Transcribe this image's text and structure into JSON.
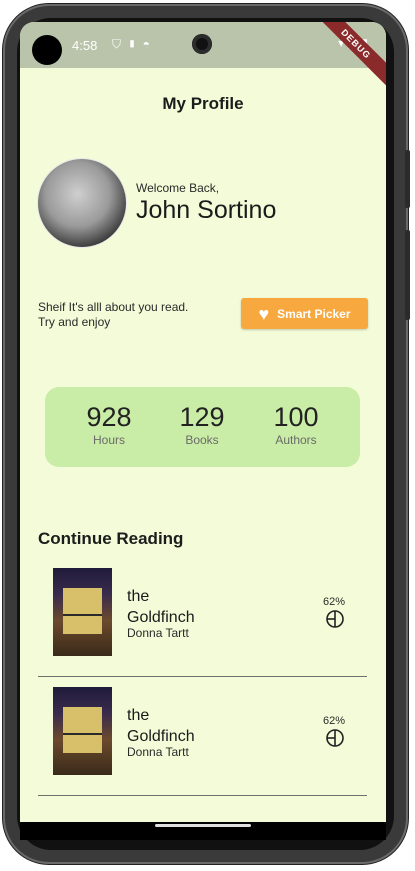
{
  "status_bar": {
    "time": "4:58",
    "debug_banner": "DEBUG"
  },
  "header": {
    "title": "My Profile"
  },
  "profile": {
    "welcome": "Welcome Back,",
    "name": "John Sortino"
  },
  "intro": {
    "line1": "Sheif It's alll about you read.",
    "line2": "Try and enjoy",
    "button_label": "Smart Picker"
  },
  "stats": [
    {
      "value": "928",
      "label": "Hours"
    },
    {
      "value": "129",
      "label": "Books"
    },
    {
      "value": "100",
      "label": "Authors"
    }
  ],
  "continue_reading": {
    "title": "Continue Reading",
    "books": [
      {
        "title_line1": "the",
        "title_line2": "Goldfinch",
        "author": "Donna Tartt",
        "progress": "62%"
      },
      {
        "title_line1": "the",
        "title_line2": "Goldfinch",
        "author": "Donna Tartt",
        "progress": "62%"
      }
    ]
  },
  "colors": {
    "accent": "#f7a83e",
    "background": "#f3fbd8",
    "stats_card": "#c9eca6"
  }
}
